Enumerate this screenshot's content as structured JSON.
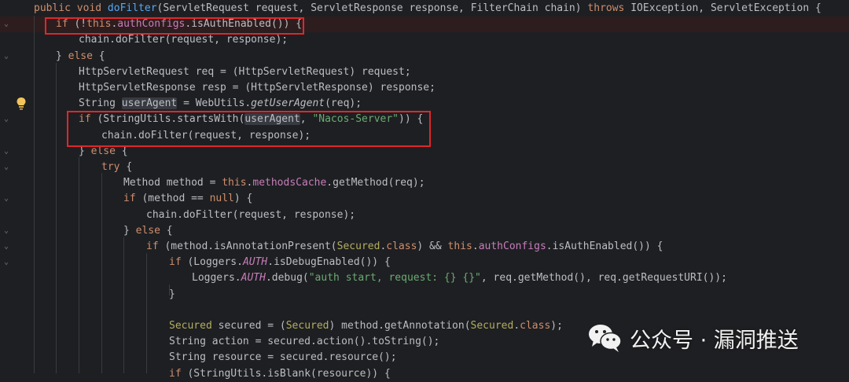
{
  "watermark": {
    "text": "公众号 · 漏洞推送",
    "icon": "wechat-icon"
  },
  "colors": {
    "background": "#1e1f22",
    "keyword": "#cf8e6d",
    "method": "#56a8f5",
    "field": "#c77dbb",
    "string": "#6aab73",
    "annotation": "#b3ae60",
    "highlight_box": "#e0262b"
  },
  "lines": [
    [
      [
        "kw",
        "public void "
      ],
      [
        "fn",
        "doFilter"
      ],
      [
        "",
        "(ServletRequest request, ServletResponse response, FilterChain chain) "
      ],
      [
        "kw",
        "throws "
      ],
      [
        "",
        "IOException, ServletException {"
      ]
    ],
    [
      [
        "kw",
        "if "
      ],
      [
        "",
        "(!"
      ],
      [
        "kw",
        "this"
      ],
      [
        "",
        "."
      ],
      [
        "fld",
        "authConfigs"
      ],
      [
        "",
        ".isAuthEnabled()) {"
      ]
    ],
    [
      [
        "",
        "chain.doFilter(request, response);"
      ]
    ],
    [
      [
        "",
        "} "
      ],
      [
        "kw",
        "else "
      ],
      [
        "",
        "{"
      ]
    ],
    [
      [
        "",
        "HttpServletRequest req = (HttpServletRequest) request;"
      ]
    ],
    [
      [
        "",
        "HttpServletResponse resp = (HttpServletResponse) response;"
      ]
    ],
    [
      [
        "",
        "String "
      ],
      [
        "hlv",
        "userAgent"
      ],
      [
        "",
        " = WebUtils."
      ],
      [
        "smc",
        "getUserAgent"
      ],
      [
        "",
        "(req);"
      ]
    ],
    [
      [
        "kw",
        "if "
      ],
      [
        "",
        "(StringUtils.startsWith("
      ],
      [
        "hlv",
        "userAgent"
      ],
      [
        "",
        ", "
      ],
      [
        "str",
        "\"Nacos-Server\""
      ],
      [
        "",
        ")) {"
      ]
    ],
    [
      [
        "",
        "chain.doFilter(request, response);"
      ]
    ],
    [
      [
        "",
        "} "
      ],
      [
        "kw",
        "else "
      ],
      [
        "",
        "{"
      ]
    ],
    [
      [
        "kw",
        "try "
      ],
      [
        "",
        "{"
      ]
    ],
    [
      [
        "",
        "Method method = "
      ],
      [
        "kw",
        "this"
      ],
      [
        "",
        "."
      ],
      [
        "fld",
        "methodsCache"
      ],
      [
        "",
        ".getMethod(req);"
      ]
    ],
    [
      [
        "kw",
        "if "
      ],
      [
        "",
        "(method == "
      ],
      [
        "kw",
        "null"
      ],
      [
        "",
        ") {"
      ]
    ],
    [
      [
        "",
        "chain.doFilter(request, response);"
      ]
    ],
    [
      [
        "",
        "} "
      ],
      [
        "kw",
        "else "
      ],
      [
        "",
        "{"
      ]
    ],
    [
      [
        "kw",
        "if "
      ],
      [
        "",
        "(method.isAnnotationPresent("
      ],
      [
        "ann",
        "Secured"
      ],
      [
        "",
        "."
      ],
      [
        "kw",
        "class"
      ],
      [
        "",
        ") && "
      ],
      [
        "kw",
        "this"
      ],
      [
        "",
        "."
      ],
      [
        "fld",
        "authConfigs"
      ],
      [
        "",
        ".isAuthEnabled()) {"
      ]
    ],
    [
      [
        "kw",
        "if "
      ],
      [
        "",
        "(Loggers."
      ],
      [
        "sfld",
        "AUTH"
      ],
      [
        "",
        ".isDebugEnabled()) {"
      ]
    ],
    [
      [
        "",
        "Loggers."
      ],
      [
        "sfld",
        "AUTH"
      ],
      [
        "",
        ".debug("
      ],
      [
        "str",
        "\"auth start, request: {} {}\""
      ],
      [
        "",
        ", req.getMethod(), req.getRequestURI());"
      ]
    ],
    [
      [
        "",
        "}"
      ]
    ],
    [
      [
        "",
        ""
      ]
    ],
    [
      [
        "ann",
        "Secured"
      ],
      [
        "",
        " secured = ("
      ],
      [
        "ann",
        "Secured"
      ],
      [
        "",
        ") method.getAnnotation("
      ],
      [
        "ann",
        "Secured"
      ],
      [
        "",
        "."
      ],
      [
        "kw",
        "class"
      ],
      [
        "",
        ");"
      ]
    ],
    [
      [
        "",
        "String action = secured.action().toString();"
      ]
    ],
    [
      [
        "",
        "String resource = secured.resource();"
      ]
    ],
    [
      [
        "kw",
        "if "
      ],
      [
        "",
        "(StringUtils.isBlank(resource)) {"
      ]
    ]
  ]
}
